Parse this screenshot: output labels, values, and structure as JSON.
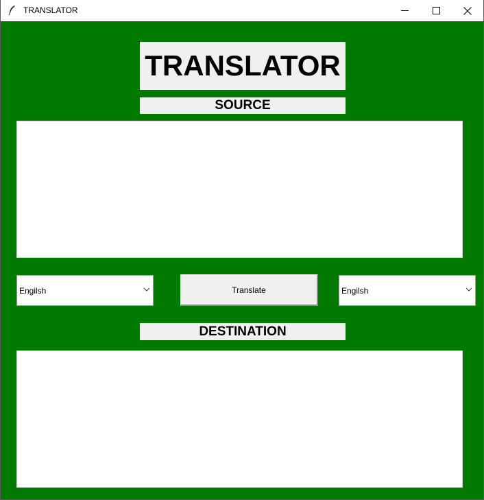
{
  "window": {
    "title": "TRANSLATOR",
    "background": "#017a01",
    "controls": [
      "minimize-icon",
      "maximize-icon",
      "close-icon"
    ]
  },
  "header": {
    "title": "TRANSLATOR"
  },
  "source": {
    "label": "SOURCE",
    "text": ""
  },
  "controls": {
    "source_language": "Engilsh",
    "translate_label": "Translate",
    "destination_language": "Engilsh"
  },
  "destination": {
    "label": "DESTINATION",
    "text": ""
  }
}
